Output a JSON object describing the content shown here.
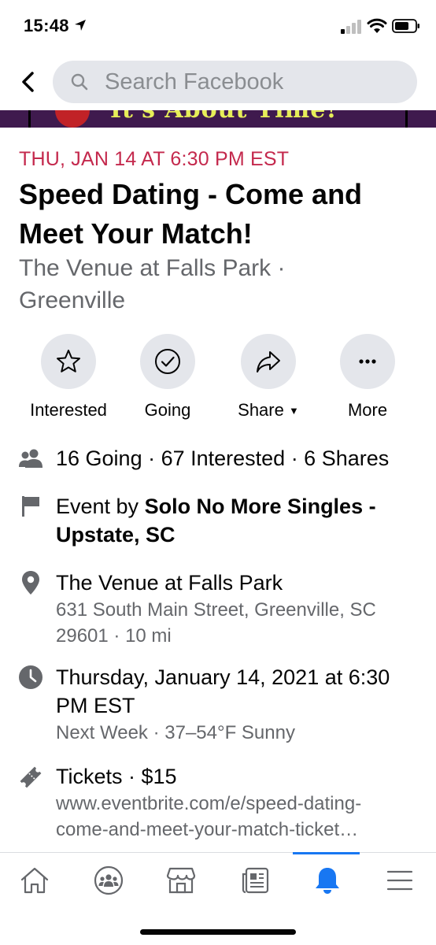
{
  "status_bar": {
    "time": "15:48",
    "icons": [
      "location-arrow-icon",
      "cellular-signal-icon",
      "wifi-icon",
      "battery-icon"
    ]
  },
  "header": {
    "search_placeholder": "Search Facebook"
  },
  "cover": {
    "visible_text": "It's About Time!"
  },
  "event": {
    "date": "THU, JAN 14 AT 6:30 PM EST",
    "title": "Speed Dating - Come and Meet Your Match!",
    "location": "The Venue at Falls Park · Greenville"
  },
  "actions": [
    {
      "label": "Interested",
      "icon": "star-icon"
    },
    {
      "label": "Going",
      "icon": "check-circle-icon"
    },
    {
      "label": "Share",
      "icon": "share-arrow-icon"
    },
    {
      "label": "More",
      "icon": "more-dots-icon"
    }
  ],
  "details": {
    "attendance": "16 Going · 67 Interested · 6 Shares",
    "host_prefix": "Event by ",
    "host_name": "Solo No More Singles - Upstate, SC",
    "venue_name": "The Venue at Falls Park",
    "venue_address": "631 South Main Street, Greenville, SC 29601 · 10 mi",
    "datetime": "Thursday, January 14, 2021 at 6:30 PM EST",
    "datetime_sub": "Next Week · 37–54°F Sunny",
    "tickets": "Tickets · $15",
    "ticket_url_line1": "www.eventbrite.com/e/speed-dating-",
    "ticket_url_line2": "come-and-meet-your-match-ticket…"
  },
  "bottom_nav": {
    "items": [
      "home-icon",
      "groups-icon",
      "marketplace-icon",
      "news-icon",
      "notifications-bell-icon",
      "menu-icon"
    ],
    "active": "notifications-bell-icon"
  },
  "colors": {
    "accent": "#1877f2",
    "date_red": "#c4294d",
    "secondary_text": "#65676b",
    "chip_bg": "#e4e6eb"
  }
}
